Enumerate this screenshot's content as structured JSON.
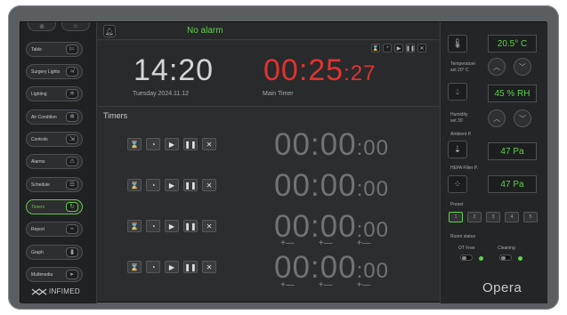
{
  "sidebar": {
    "top_icons": [
      "⊚",
      "⌂"
    ],
    "items": [
      {
        "label": "Table",
        "icon": "table-icon",
        "glyph": "⊨"
      },
      {
        "label": "Surgery Lights",
        "icon": "surgery-light-icon",
        "glyph": "≉"
      },
      {
        "label": "Lighting",
        "icon": "light-bulb-icon",
        "glyph": "✳"
      },
      {
        "label": "Air Condition",
        "icon": "snowflake-icon",
        "glyph": "❄"
      },
      {
        "label": "Controls",
        "icon": "controls-icon",
        "glyph": "⇲"
      },
      {
        "label": "Alarms",
        "icon": "warning-icon",
        "glyph": "⚠"
      },
      {
        "label": "Schedule",
        "icon": "schedule-icon",
        "glyph": "☰"
      },
      {
        "label": "Timers",
        "icon": "timer-icon",
        "glyph": "↻"
      },
      {
        "label": "Report",
        "icon": "report-icon",
        "glyph": "⌁"
      },
      {
        "label": "Graph",
        "icon": "graph-icon",
        "glyph": "▮"
      },
      {
        "label": "Multimedia",
        "icon": "multimedia-icon",
        "glyph": "▸"
      }
    ],
    "active": "Timers",
    "logo": "INFIMED"
  },
  "topbar": {
    "alarm_text": "No alarm"
  },
  "clock": {
    "time": "14:20",
    "date": "Tuesday 2024.11.12"
  },
  "main_timer": {
    "hhmm": "00:25",
    "sec": ":27",
    "label": "Main Timer"
  },
  "timers": {
    "title": "Timers",
    "buttons": [
      "⌛",
      "◔",
      "▶",
      "❚❚",
      "✕"
    ],
    "rows": [
      {
        "hhmm": "00:00",
        "sec": ":00"
      },
      {
        "hhmm": "00:00",
        "sec": ":00"
      },
      {
        "hhmm": "00:00",
        "sec": ":00"
      },
      {
        "hhmm": "00:00",
        "sec": ":00"
      }
    ],
    "plus_minus": "+—"
  },
  "right": {
    "temperature": {
      "value": "20.5° C",
      "label": "Temperature",
      "set": "set 20° C"
    },
    "humidity": {
      "value": "45 % RH",
      "label": "Humidity",
      "set": "set 30"
    },
    "ambient": {
      "value": "47 Pa",
      "label": "Ambient P."
    },
    "hepa": {
      "value": "47 Pa",
      "label": "HEPA Filter P."
    },
    "preset": {
      "label": "Preset",
      "values": [
        "1",
        "2",
        "3",
        "4",
        "5"
      ],
      "selected": "1"
    },
    "room_status": {
      "label": "Room status",
      "of_free": "OT Free",
      "cleaning": "Cleaning"
    },
    "brand": "Opera"
  },
  "colors": {
    "accent": "#5fd24a",
    "timer_red": "#e0332f"
  }
}
